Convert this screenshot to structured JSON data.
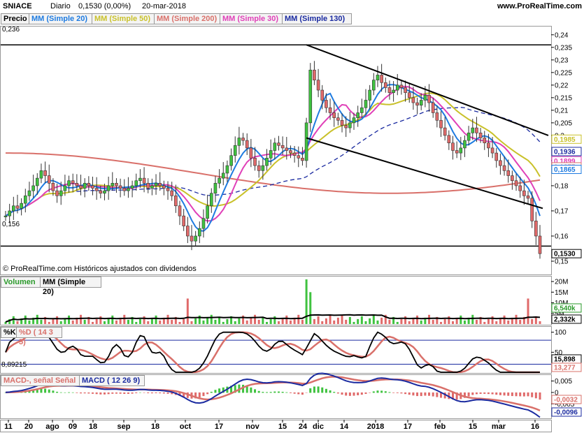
{
  "header": {
    "symbol": "SNIACE",
    "period": "Diario",
    "last": "0,1530 (0,00%)",
    "date": "20-mar-2018",
    "site": "www.ProRealTime.com"
  },
  "price_panel": {
    "legend": [
      {
        "label": "Precio",
        "color": "#000000"
      },
      {
        "label": "MM (Simple 20)",
        "color": "#1e7be0"
      },
      {
        "label": "MM (Simple 50)",
        "color": "#c9c12a"
      },
      {
        "label": "MM (Simple 200)",
        "color": "#d9706a"
      },
      {
        "label": "MM (Simple 30)",
        "color": "#e040b8"
      },
      {
        "label": "MM (Simple 130)",
        "color": "#1a2aa0"
      }
    ],
    "level_high": "0,236",
    "level_low": "0,156",
    "credit": "© ProRealTime.com  Históricos ajustados con dividendos",
    "yticks": [
      "0,24",
      "0,235",
      "0,23",
      "0,225",
      "0,22",
      "0,215",
      "0,21",
      "0,205",
      "0,2",
      "0,19",
      "0,18",
      "0,17",
      "0,16",
      "0,15"
    ],
    "tags": [
      {
        "label": "0,1985",
        "color": "#c9c12a"
      },
      {
        "label": "0,1936",
        "color": "#1a2aa0"
      },
      {
        "label": "0,1899",
        "color": "#e040b8"
      },
      {
        "label": "0,1875",
        "color": "#d9706a"
      },
      {
        "label": "0,1865",
        "color": "#1e7be0"
      },
      {
        "label": "0,1530",
        "color": "#000000"
      }
    ]
  },
  "volume_panel": {
    "legend": [
      {
        "label": "Volumen",
        "color": "#2a9a2a"
      },
      {
        "label": "MM (Simple 20)",
        "color": "#000000"
      }
    ],
    "yticks": [
      "20M",
      "15M",
      "10M",
      "5M"
    ],
    "tags": [
      {
        "label": "6,540k",
        "color": "#2a9a2a"
      },
      {
        "label": "2,332k",
        "color": "#000000"
      }
    ]
  },
  "stoch_panel": {
    "legend": [
      {
        "label": "%K",
        "color": "#000000"
      },
      {
        "label": "%D ( 14 3 5)",
        "color": "#d9706a"
      }
    ],
    "level_label": "8,89215",
    "yticks": [
      "100",
      "50"
    ],
    "tags": [
      {
        "label": "15,898",
        "color": "#000000"
      },
      {
        "label": "13,277",
        "color": "#d9706a"
      }
    ]
  },
  "macd_panel": {
    "legend": [
      {
        "label": "MACD-, señal Señal",
        "color": "#d9706a"
      },
      {
        "label": "MACD ( 12 26 9)",
        "color": "#1a2aa0"
      }
    ],
    "yticks": [
      "0,005",
      "0",
      "-0,005"
    ],
    "tags": [
      {
        "label": "-0,0032",
        "color": "#d9706a"
      },
      {
        "label": "-0,0096",
        "color": "#1a2aa0"
      }
    ]
  },
  "x_labels": [
    "11",
    "20",
    "ago",
    "09",
    "18",
    "sep",
    "18",
    "oct",
    "17",
    "nov",
    "15",
    "24",
    "dic",
    "14",
    "2018",
    "17",
    "feb",
    "15",
    "mar",
    "16"
  ],
  "chart_data": {
    "type": "candlestick",
    "price_ylim": [
      0.145,
      0.243
    ],
    "closes": [
      0.168,
      0.17,
      0.172,
      0.171,
      0.173,
      0.176,
      0.178,
      0.18,
      0.183,
      0.186,
      0.184,
      0.181,
      0.178,
      0.176,
      0.178,
      0.18,
      0.182,
      0.181,
      0.18,
      0.179,
      0.181,
      0.18,
      0.179,
      0.178,
      0.177,
      0.178,
      0.18,
      0.181,
      0.18,
      0.179,
      0.178,
      0.179,
      0.18,
      0.182,
      0.183,
      0.181,
      0.179,
      0.18,
      0.181,
      0.18,
      0.179,
      0.178,
      0.176,
      0.172,
      0.168,
      0.164,
      0.16,
      0.158,
      0.16,
      0.163,
      0.167,
      0.172,
      0.177,
      0.181,
      0.183,
      0.185,
      0.188,
      0.192,
      0.196,
      0.199,
      0.198,
      0.195,
      0.191,
      0.188,
      0.186,
      0.188,
      0.191,
      0.194,
      0.197,
      0.196,
      0.195,
      0.194,
      0.193,
      0.192,
      0.191,
      0.19,
      0.205,
      0.226,
      0.222,
      0.218,
      0.214,
      0.211,
      0.209,
      0.207,
      0.206,
      0.204,
      0.203,
      0.205,
      0.207,
      0.209,
      0.211,
      0.214,
      0.218,
      0.222,
      0.224,
      0.221,
      0.219,
      0.217,
      0.218,
      0.22,
      0.219,
      0.217,
      0.215,
      0.213,
      0.212,
      0.214,
      0.216,
      0.213,
      0.209,
      0.206,
      0.203,
      0.2,
      0.197,
      0.194,
      0.193,
      0.195,
      0.198,
      0.201,
      0.203,
      0.201,
      0.199,
      0.197,
      0.195,
      0.193,
      0.19,
      0.188,
      0.186,
      0.184,
      0.182,
      0.18,
      0.178,
      0.176,
      0.175,
      0.166,
      0.16,
      0.153
    ],
    "ma_colors": [
      "#1e7be0",
      "#c9c12a",
      "#d9706a",
      "#e040b8",
      "#1a2aa0"
    ]
  }
}
